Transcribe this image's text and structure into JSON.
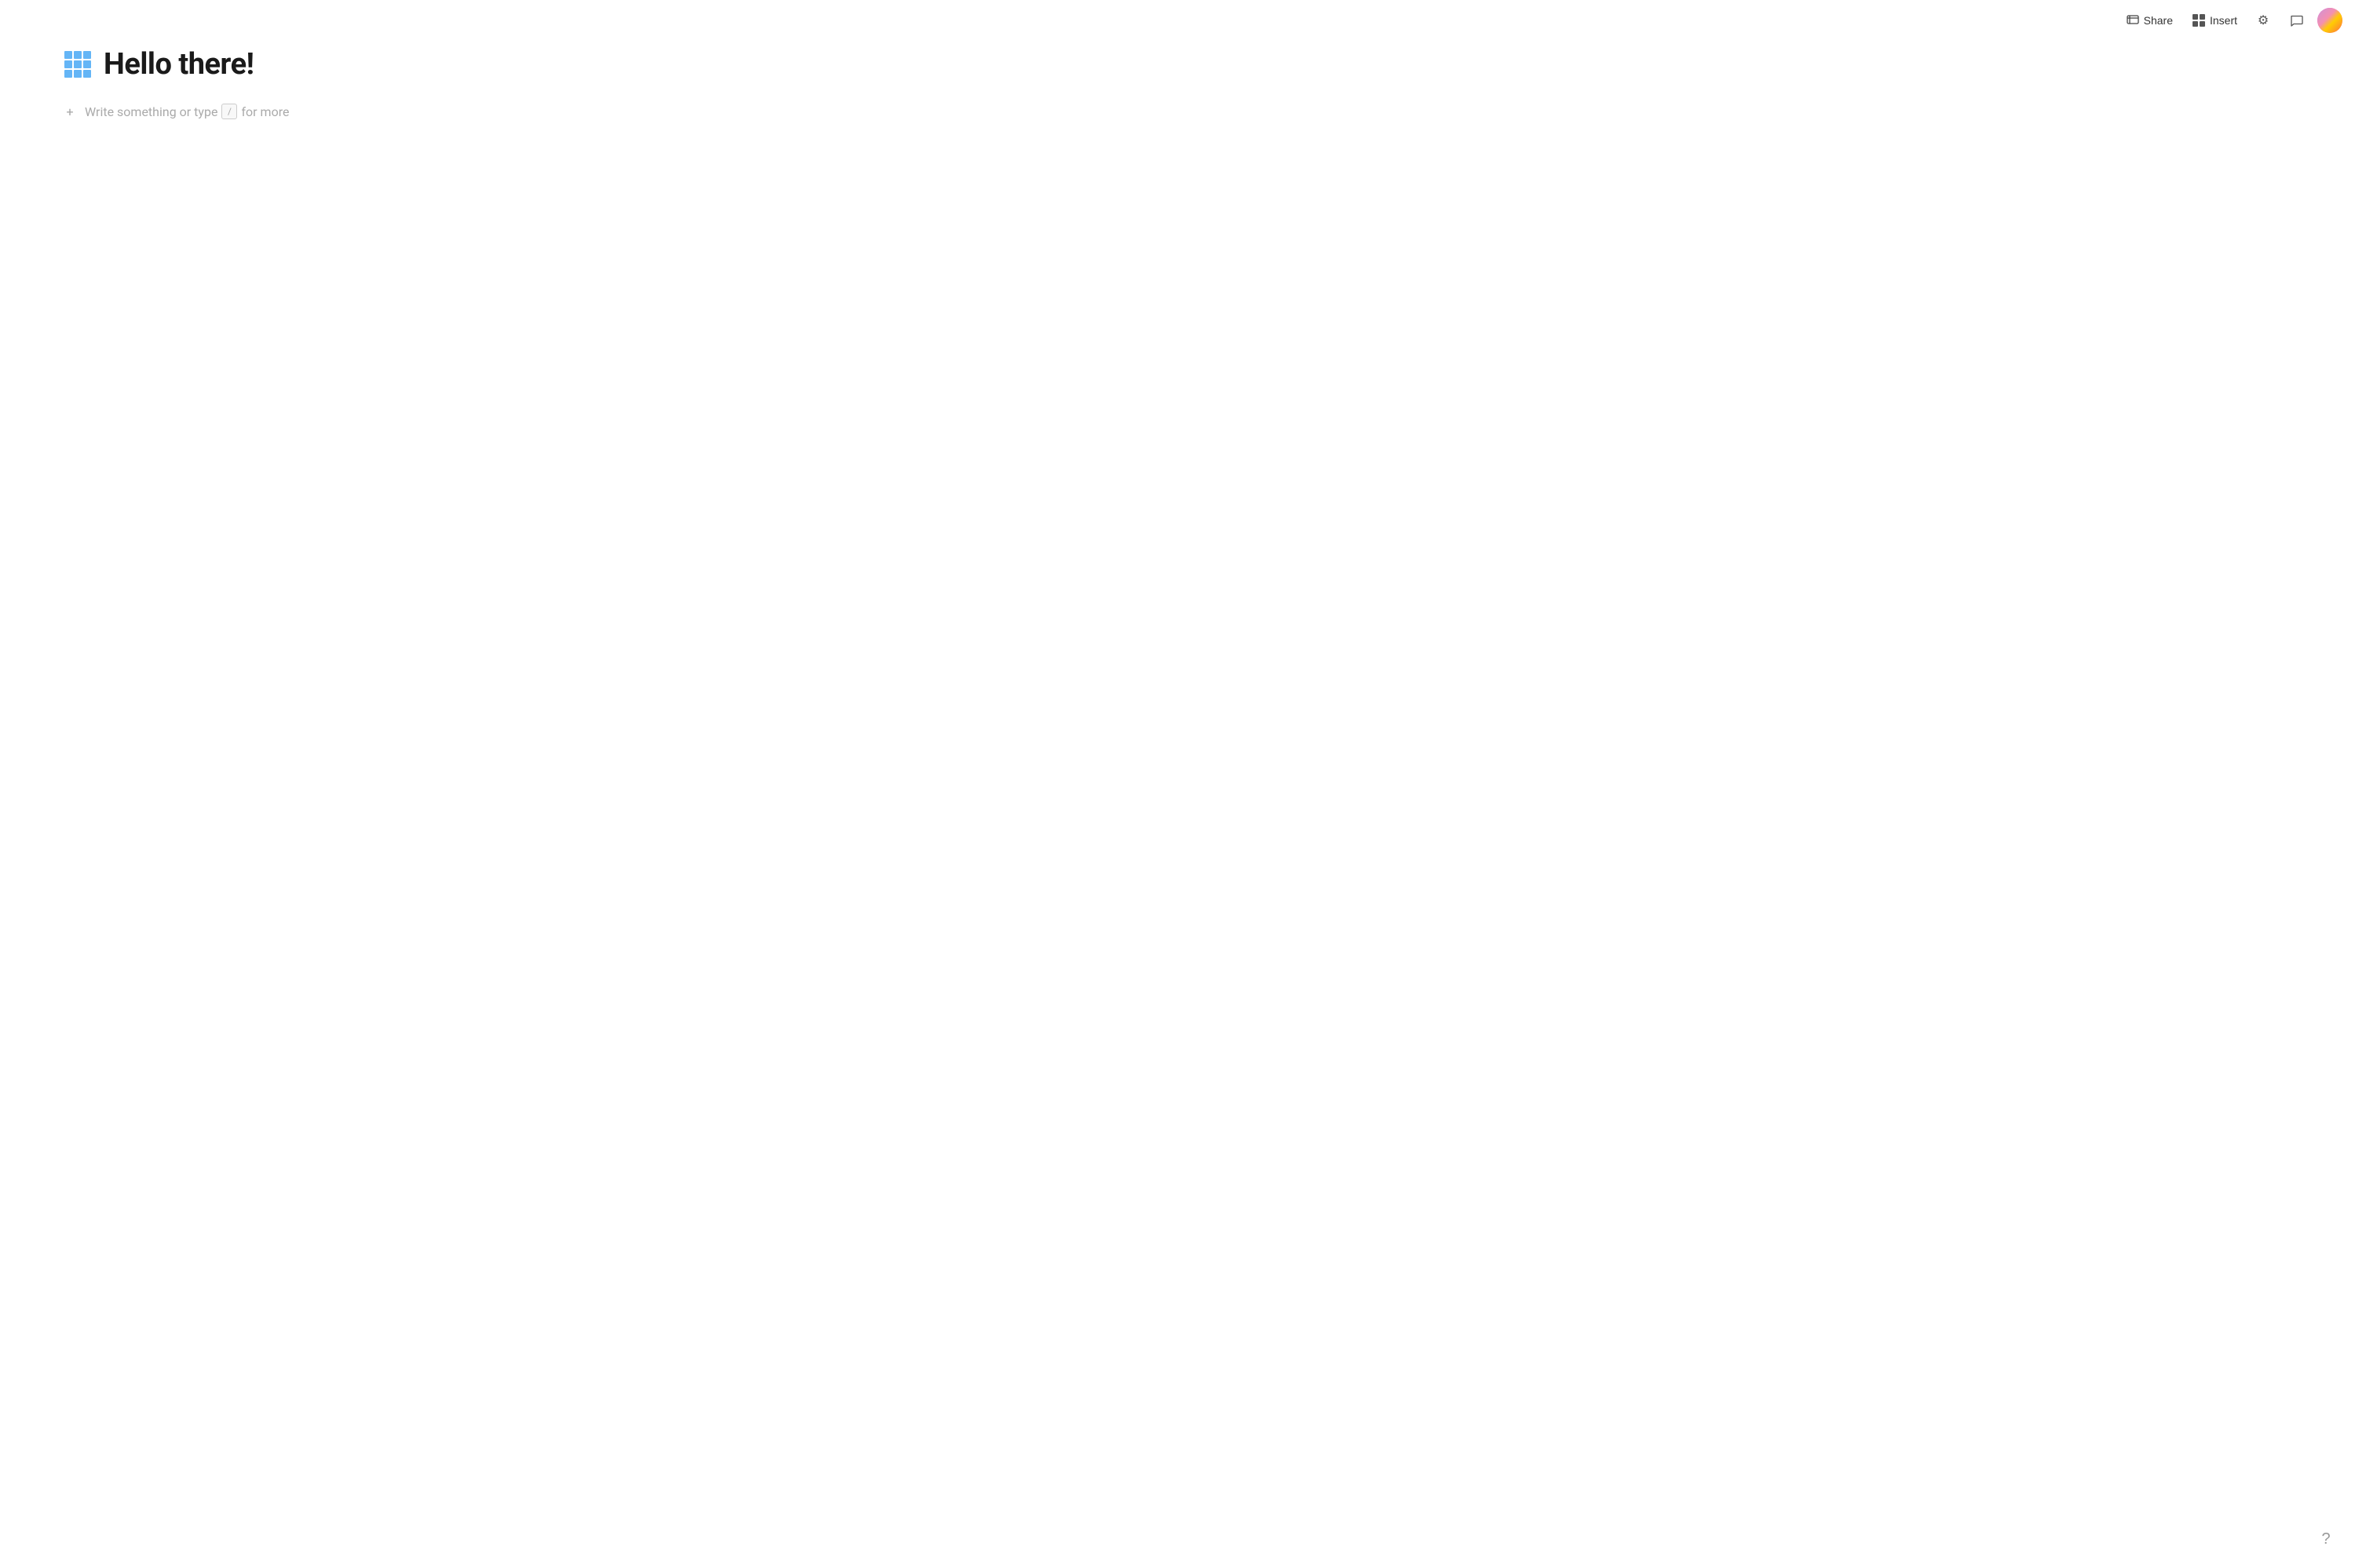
{
  "toolbar": {
    "share_label": "Share",
    "insert_label": "Insert",
    "settings_label": "Settings",
    "comment_label": "Comment"
  },
  "page": {
    "title": "Hello there!",
    "placeholder_before_slash": "Write something or type ",
    "slash_key": "/",
    "placeholder_after_slash": " for more"
  },
  "help": {
    "label": "?"
  },
  "colors": {
    "grid_icon": "#64b5f6",
    "placeholder_text": "#aaaaaa",
    "title_text": "#1a1a1a"
  }
}
